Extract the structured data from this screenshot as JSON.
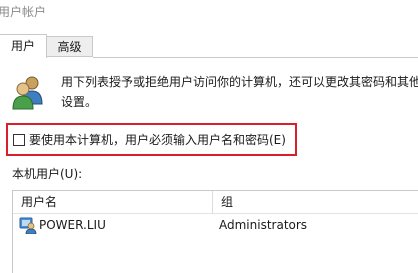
{
  "window": {
    "title": "用户帐户"
  },
  "tabs": [
    {
      "label": "用户"
    },
    {
      "label": "高级"
    }
  ],
  "description": "用下列表授予或拒绝用户访问你的计算机，还可以更改其密码和其他设置。",
  "require_login": {
    "label": "要使用本计算机，用户必须输入用户名和密码(E)",
    "checked": false
  },
  "users_section_label": "本机用户(U):",
  "users_table": {
    "columns": [
      "用户名",
      "组"
    ],
    "rows": [
      {
        "name": "POWER.LIU",
        "group": "Administrators"
      }
    ]
  },
  "icons": {
    "users": "users-group-icon",
    "user": "user-account-icon"
  },
  "colors": {
    "highlight_border": "#d9202a"
  }
}
